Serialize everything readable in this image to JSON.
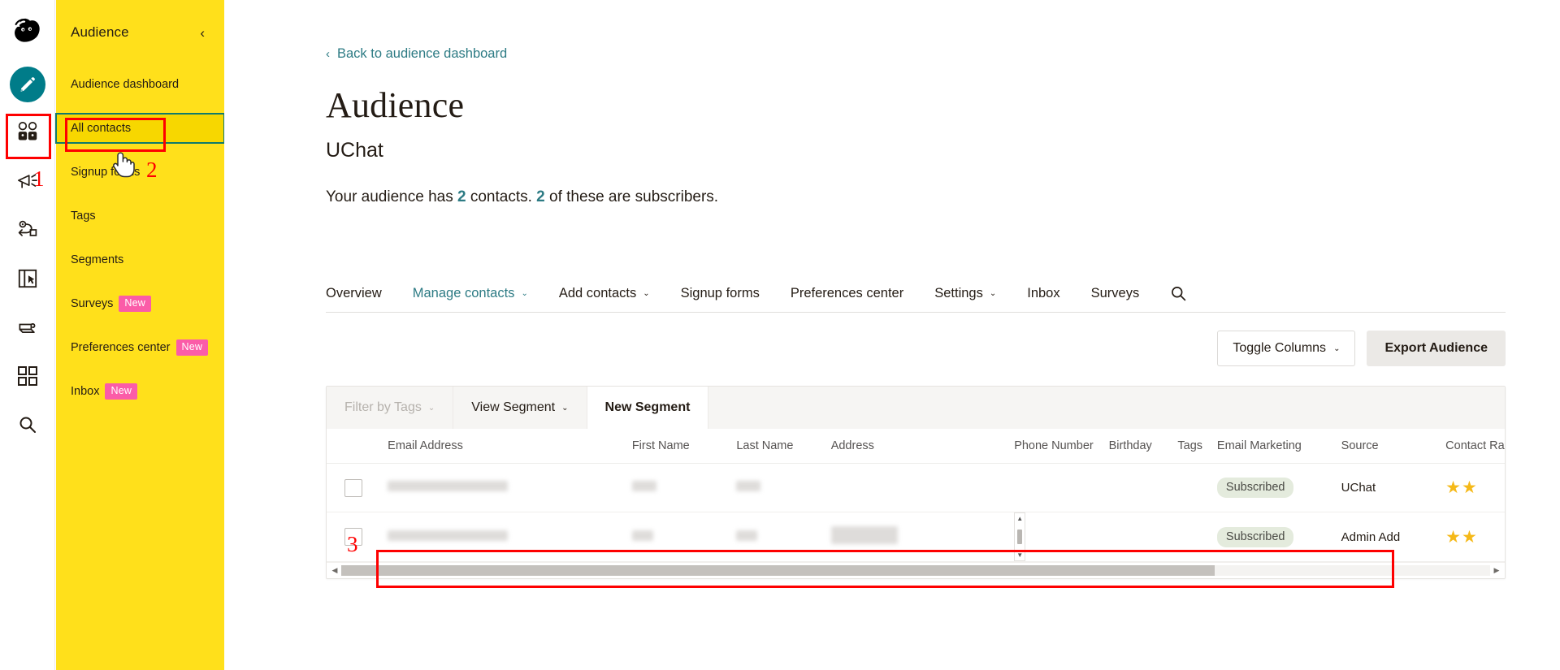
{
  "rail": {
    "items": [
      {
        "name": "mailchimp-logo",
        "label": "Mailchimp"
      },
      {
        "name": "compose-icon",
        "label": "Create"
      },
      {
        "name": "audience-icon",
        "label": "Audience"
      },
      {
        "name": "campaigns-icon",
        "label": "Campaigns"
      },
      {
        "name": "automations-icon",
        "label": "Automations"
      },
      {
        "name": "website-icon",
        "label": "Website"
      },
      {
        "name": "content-icon",
        "label": "Content"
      },
      {
        "name": "integrations-icon",
        "label": "Integrations"
      },
      {
        "name": "search-icon",
        "label": "Search"
      }
    ]
  },
  "sidebar": {
    "title": "Audience",
    "collapse_icon": "‹",
    "items": [
      {
        "label": "Audience dashboard",
        "badge": "",
        "active": false
      },
      {
        "label": "All contacts",
        "badge": "",
        "active": true
      },
      {
        "label": "Signup forms",
        "badge": "",
        "active": false
      },
      {
        "label": "Tags",
        "badge": "",
        "active": false
      },
      {
        "label": "Segments",
        "badge": "",
        "active": false
      },
      {
        "label": "Surveys",
        "badge": "New",
        "active": false
      },
      {
        "label": "Preferences center",
        "badge": "New",
        "active": false
      },
      {
        "label": "Inbox",
        "badge": "New",
        "active": false
      }
    ]
  },
  "main": {
    "back_link": "Back to audience dashboard",
    "back_chevron": "‹",
    "page_title": "Audience",
    "audience_name": "UChat",
    "stats": {
      "prefix": "Your audience has ",
      "contacts_count": "2",
      "middle": " contacts. ",
      "subscribers_count": "2",
      "suffix": " of these are subscribers."
    },
    "tabs": [
      {
        "label": "Overview",
        "caret": "",
        "active": false
      },
      {
        "label": "Manage contacts",
        "caret": "⌄",
        "active": true
      },
      {
        "label": "Add contacts",
        "caret": "⌄",
        "active": false
      },
      {
        "label": "Signup forms",
        "caret": "",
        "active": false
      },
      {
        "label": "Preferences center",
        "caret": "",
        "active": false
      },
      {
        "label": "Settings",
        "caret": "⌄",
        "active": false
      },
      {
        "label": "Inbox",
        "caret": "",
        "active": false
      },
      {
        "label": "Surveys",
        "caret": "",
        "active": false
      }
    ],
    "search_tab_icon": "search-icon",
    "toolbar": {
      "toggle_columns": "Toggle Columns",
      "toggle_columns_caret": "⌄",
      "export_audience": "Export Audience"
    }
  },
  "table": {
    "filters": [
      {
        "label": "Filter by Tags",
        "caret": "⌄",
        "style": "muted"
      },
      {
        "label": "View Segment",
        "caret": "⌄",
        "style": "normal"
      },
      {
        "label": "New Segment",
        "caret": "",
        "style": "white"
      }
    ],
    "columns": [
      "Email Address",
      "First Name",
      "Last Name",
      "Address",
      "Phone Number",
      "Birthday",
      "Tags",
      "Email Marketing",
      "Source",
      "Contact Rating"
    ],
    "rows": [
      {
        "email": "",
        "first_name": "",
        "last_name": "",
        "address": "",
        "phone": "",
        "birthday": "",
        "tags": "",
        "email_marketing": "Subscribed",
        "source": "UChat",
        "rating": "★★"
      },
      {
        "email": "",
        "first_name": "",
        "last_name": "",
        "address": "",
        "phone": "",
        "birthday": "",
        "tags": "",
        "email_marketing": "Subscribed",
        "source": "Admin Add",
        "rating": "★★"
      }
    ],
    "hscroll_left_arrow": "◀",
    "hscroll_right_arrow": "▶"
  },
  "annotations": {
    "step_1": "1",
    "step_2": "2",
    "step_3": "3",
    "color": "#fe0000"
  },
  "colors": {
    "sidebar_yellow": "#ffe01b",
    "accent_teal": "#2d7b84",
    "compose_teal": "#007c89",
    "badge_pink": "#fb5ca8",
    "star_gold": "#f5b919",
    "subscribed_green": "#e4ebdd"
  }
}
